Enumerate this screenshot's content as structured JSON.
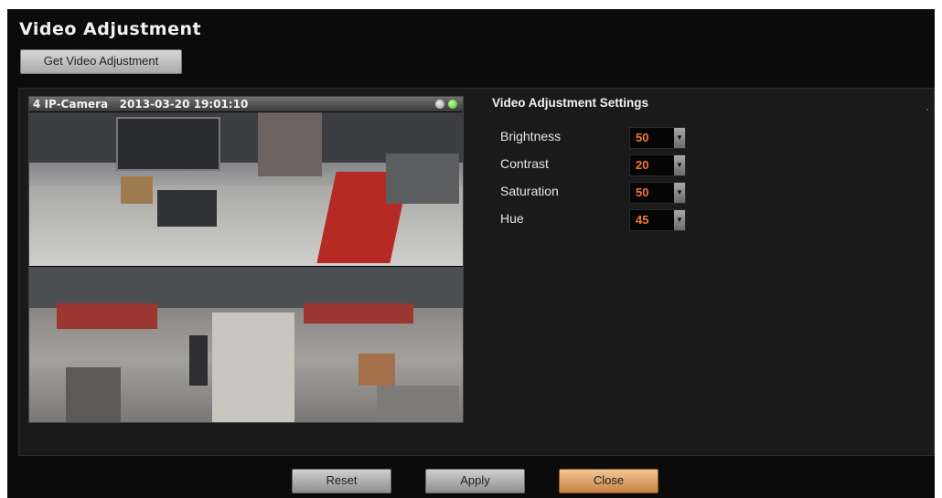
{
  "window": {
    "title": "Video Adjustment",
    "get_button_label": "Get Video Adjustment"
  },
  "camera": {
    "name": "4 IP-Camera",
    "datetime": "2013-03-20 19:01:10",
    "status_indicators": [
      "gray",
      "green"
    ]
  },
  "settings": {
    "title": "Video Adjustment Settings",
    "items": [
      {
        "label": "Brightness",
        "value": "50"
      },
      {
        "label": "Contrast",
        "value": "20"
      },
      {
        "label": "Saturation",
        "value": "50"
      },
      {
        "label": "Hue",
        "value": "45"
      }
    ]
  },
  "footer": {
    "reset_label": "Reset",
    "apply_label": "Apply",
    "close_label": "Close"
  },
  "colors": {
    "background": "#0b0b0b",
    "value_text": "#f07a34",
    "close_button": "#e0a86e"
  }
}
